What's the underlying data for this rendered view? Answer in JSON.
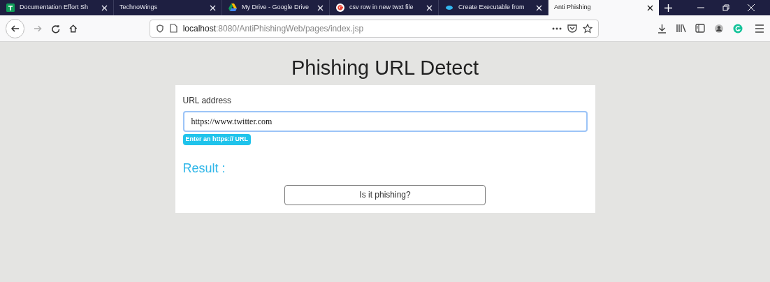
{
  "tabs": [
    {
      "title": "Documentation Effort Sh",
      "selected": false
    },
    {
      "title": "TechnoWings",
      "selected": false
    },
    {
      "title": "My Drive - Google Drive",
      "selected": false
    },
    {
      "title": "csv row in new twxt file",
      "selected": false
    },
    {
      "title": "Create Executable from",
      "selected": false
    },
    {
      "title": "Anti Phishing",
      "selected": true
    }
  ],
  "address_bar": {
    "host": "localhost",
    "path": ":8080/AntiPhishingWeb/pages/index.jsp"
  },
  "page": {
    "heading": "Phishing URL Detect",
    "field_label": "URL address",
    "url_value": "https://www.twitter.com",
    "hint_badge": "Enter an https:// URL",
    "result_label": "Result :",
    "submit_button": "Is it phishing?"
  }
}
